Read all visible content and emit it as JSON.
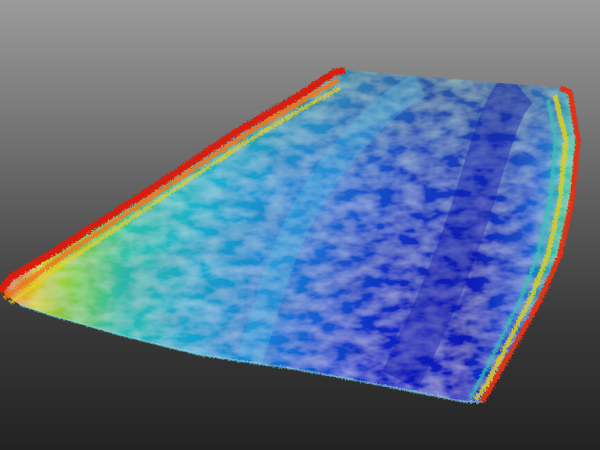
{
  "scene": {
    "subject": "3d-bathymetry-point-cloud",
    "colormap": "jet",
    "background_top_color": "#9b9b9b",
    "background_bottom_color": "#222222",
    "colors": {
      "deep": "#0a14c8",
      "mid_deep": "#1a6ee0",
      "mid": "#18b8d8",
      "shallow": "#7ad850",
      "high": "#f0d020",
      "bank": "#e02818"
    }
  }
}
